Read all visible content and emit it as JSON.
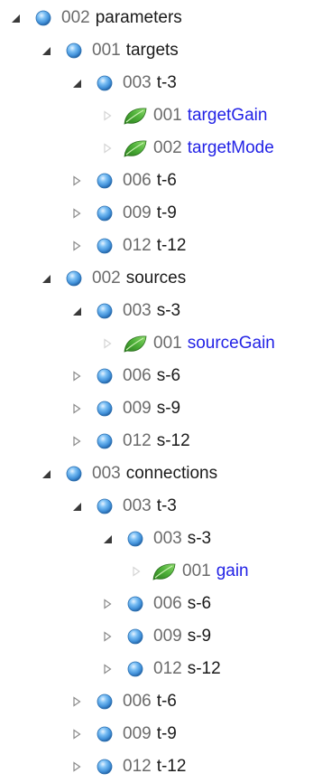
{
  "tree": [
    {
      "code": "002",
      "label": "parameters",
      "state": "expanded",
      "kind": "group"
    },
    {
      "code": "001",
      "label": "targets",
      "state": "expanded",
      "kind": "group"
    },
    {
      "code": "003",
      "label": "t-3",
      "state": "expanded",
      "kind": "group"
    },
    {
      "code": "001",
      "label": "targetGain",
      "state": "leaf",
      "kind": "parameter"
    },
    {
      "code": "002",
      "label": "targetMode",
      "state": "leaf",
      "kind": "parameter"
    },
    {
      "code": "006",
      "label": "t-6",
      "state": "collapsed",
      "kind": "group"
    },
    {
      "code": "009",
      "label": "t-9",
      "state": "collapsed",
      "kind": "group"
    },
    {
      "code": "012",
      "label": "t-12",
      "state": "collapsed",
      "kind": "group"
    },
    {
      "code": "002",
      "label": "sources",
      "state": "expanded",
      "kind": "group"
    },
    {
      "code": "003",
      "label": "s-3",
      "state": "expanded",
      "kind": "group"
    },
    {
      "code": "001",
      "label": "sourceGain",
      "state": "leaf",
      "kind": "parameter"
    },
    {
      "code": "006",
      "label": "s-6",
      "state": "collapsed",
      "kind": "group"
    },
    {
      "code": "009",
      "label": "s-9",
      "state": "collapsed",
      "kind": "group"
    },
    {
      "code": "012",
      "label": "s-12",
      "state": "collapsed",
      "kind": "group"
    },
    {
      "code": "003",
      "label": "connections",
      "state": "expanded",
      "kind": "group"
    },
    {
      "code": "003",
      "label": "t-3",
      "state": "expanded",
      "kind": "group"
    },
    {
      "code": "003",
      "label": "s-3",
      "state": "expanded",
      "kind": "group"
    },
    {
      "code": "001",
      "label": "gain",
      "state": "leaf",
      "kind": "parameter"
    },
    {
      "code": "006",
      "label": "s-6",
      "state": "collapsed",
      "kind": "group"
    },
    {
      "code": "009",
      "label": "s-9",
      "state": "collapsed",
      "kind": "group"
    },
    {
      "code": "012",
      "label": "s-12",
      "state": "collapsed",
      "kind": "group"
    },
    {
      "code": "006",
      "label": "t-6",
      "state": "collapsed",
      "kind": "group"
    },
    {
      "code": "009",
      "label": "t-9",
      "state": "collapsed",
      "kind": "group"
    },
    {
      "code": "012",
      "label": "t-12",
      "state": "collapsed",
      "kind": "group"
    }
  ],
  "icons": {
    "node": "blue-sphere-icon",
    "parameter": "leaf-icon",
    "expanded": "expanded-arrow-icon",
    "collapsed": "collapsed-arrow-icon"
  },
  "colors": {
    "code": "#6b6b6b",
    "label": "#1a1a1a",
    "parameter_label": "#2323e6",
    "sphere": "#3f8fd8",
    "leaf": "#3f9a2c"
  }
}
